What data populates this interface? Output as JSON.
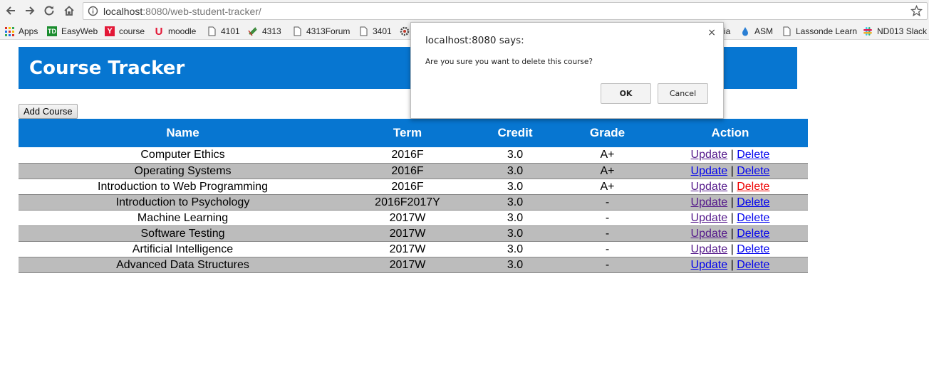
{
  "browser": {
    "url_host": "localhost",
    "url_path": ":8080/web-student-tracker/",
    "bookmarks": [
      {
        "label": "Apps",
        "icon": "apps-grid-icon"
      },
      {
        "label": "EasyWeb",
        "icon": "td-bank-icon"
      },
      {
        "label": "course",
        "icon": "york-y-icon"
      },
      {
        "label": "moodle",
        "icon": "moodle-u-icon"
      },
      {
        "label": "4101",
        "icon": "page-icon"
      },
      {
        "label": "4313",
        "icon": "puzzle-icon"
      },
      {
        "label": "4313Forum",
        "icon": "page-icon"
      },
      {
        "label": "3401",
        "icon": "page-icon"
      },
      {
        "label": "ia",
        "icon": "gear-icon"
      },
      {
        "label": "ASM",
        "icon": "drop-icon"
      },
      {
        "label": "Lassonde Learn",
        "icon": "page-icon"
      },
      {
        "label": "ND013 Slack",
        "icon": "slack-icon"
      }
    ]
  },
  "page": {
    "title": "Course Tracker",
    "add_button": "Add Course"
  },
  "table": {
    "headers": [
      "Name",
      "Term",
      "Credit",
      "Grade",
      "Action"
    ],
    "update_label": "Update",
    "delete_label": "Delete",
    "separator": "|",
    "rows": [
      {
        "name": "Computer Ethics",
        "term": "2016F",
        "credit": "3.0",
        "grade": "A+"
      },
      {
        "name": "Operating Systems",
        "term": "2016F",
        "credit": "3.0",
        "grade": "A+"
      },
      {
        "name": "Introduction to Web Programming",
        "term": "2016F",
        "credit": "3.0",
        "grade": "A+"
      },
      {
        "name": "Introduction to Psychology",
        "term": "2016F2017Y",
        "credit": "3.0",
        "grade": "-"
      },
      {
        "name": "Machine Learning",
        "term": "2017W",
        "credit": "3.0",
        "grade": "-"
      },
      {
        "name": "Software Testing",
        "term": "2017W",
        "credit": "3.0",
        "grade": "-"
      },
      {
        "name": "Artificial Intelligence",
        "term": "2017W",
        "credit": "3.0",
        "grade": "-"
      },
      {
        "name": "Advanced Data Structures",
        "term": "2017W",
        "credit": "3.0",
        "grade": "-"
      }
    ]
  },
  "dialog": {
    "title": "localhost:8080 says:",
    "message": "Are you sure you want to delete this course?",
    "ok_label": "OK",
    "cancel_label": "Cancel",
    "close_glyph": "×"
  },
  "colors": {
    "accent": "#0776d1",
    "alt_row": "#bcbcbc",
    "link": "#0000ee",
    "link_visited": "#551a8b",
    "link_active": "#ee0000"
  }
}
